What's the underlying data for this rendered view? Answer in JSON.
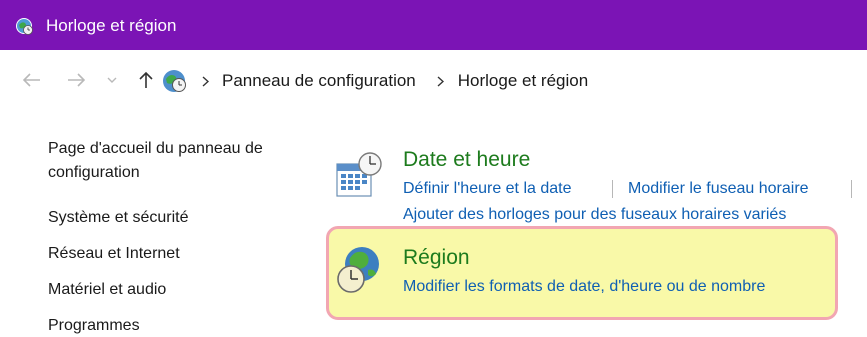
{
  "window": {
    "title": "Horloge et région",
    "icon": "clock-globe-icon",
    "titlebar_color": "#7b14b5"
  },
  "address": {
    "back_icon": "arrow-left-icon",
    "forward_icon": "arrow-right-icon",
    "recent_icon": "chevron-down-icon",
    "up_icon": "arrow-up-icon",
    "breadcrumbs": [
      {
        "label": "Panneau de configuration"
      },
      {
        "label": "Horloge et région"
      }
    ]
  },
  "sidebar": {
    "items": [
      {
        "label": "Page d'accueil du panneau de"
      },
      {
        "label": "configuration"
      },
      {
        "label": "Système et sécurité"
      },
      {
        "label": "Réseau et Internet"
      },
      {
        "label": "Matériel et audio"
      },
      {
        "label": "Programmes"
      }
    ]
  },
  "sections": {
    "datetime": {
      "title": "Date et heure",
      "icon": "calendar-clock-icon",
      "links": [
        {
          "label": "Définir l'heure et la date"
        },
        {
          "label": "Modifier le fuseau horaire"
        },
        {
          "label": "Ajouter des horloges pour des fuseaux horaires variés"
        }
      ]
    },
    "region": {
      "title": "Région",
      "icon": "globe-clock-icon",
      "links": [
        {
          "label": "Modifier les formats de date, d'heure ou de nombre"
        }
      ],
      "highlight_color": "#f9f9a8",
      "highlight_border": "#f2a6b2"
    }
  },
  "colors": {
    "accent_title": "#1d7b1d",
    "link": "#0f5fb3"
  }
}
